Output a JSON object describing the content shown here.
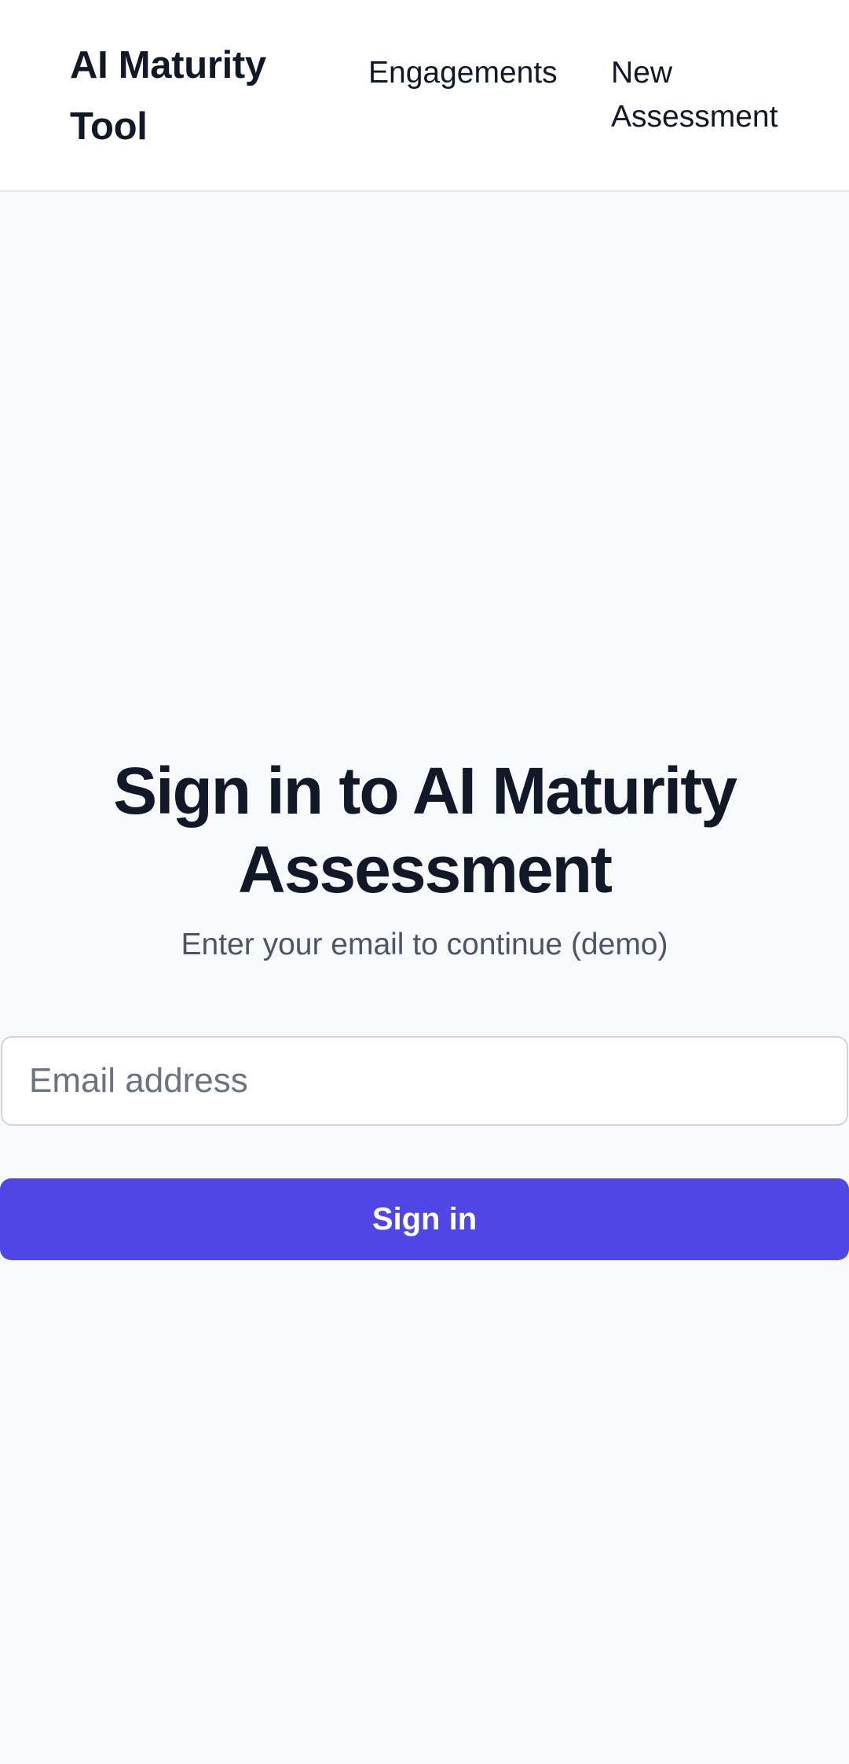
{
  "header": {
    "brand": "AI Maturity Tool",
    "nav": {
      "engagements": "Engagements",
      "new_assessment": "New Assessment"
    }
  },
  "signin": {
    "title": "Sign in to AI Maturity Assessment",
    "subtitle": "Enter your email to continue (demo)",
    "email_placeholder": "Email address",
    "email_value": "",
    "button_label": "Sign in"
  },
  "colors": {
    "background": "#f8f9fb",
    "header_background": "#ffffff",
    "text_primary": "#111827",
    "text_secondary": "#4b5563",
    "accent": "#4f46e5"
  }
}
